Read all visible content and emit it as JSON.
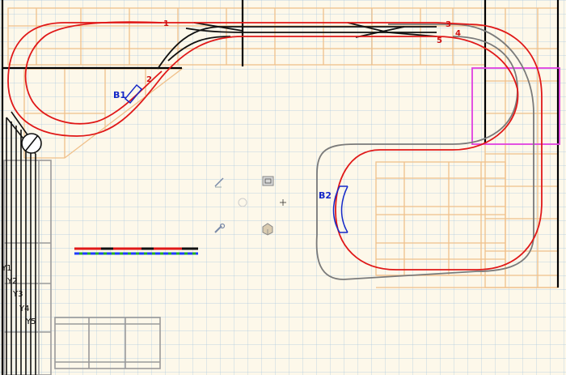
{
  "canvas": {
    "background": "#fdf8ea",
    "grid_color": "#a9c7e0",
    "bench_color": "#f0c08a",
    "main_track_color": "#e01818",
    "siding_color": "#111111",
    "alt_track_color": "#808080",
    "block_color": "#1428c8",
    "selection_color": "#e040e0"
  },
  "track_labels": {
    "t1": "1",
    "t2": "2",
    "t3": "3",
    "t4": "4",
    "t5": "5"
  },
  "blocks": {
    "b1": "B1",
    "b2": "B2"
  },
  "yard_tracks": [
    "Y1",
    "Y2",
    "Y3",
    "Y4",
    "Y5"
  ],
  "toolbar_icons": [
    "pencil-icon",
    "block-icon",
    "crosshair-icon",
    "wrench-icon",
    "package-icon"
  ]
}
